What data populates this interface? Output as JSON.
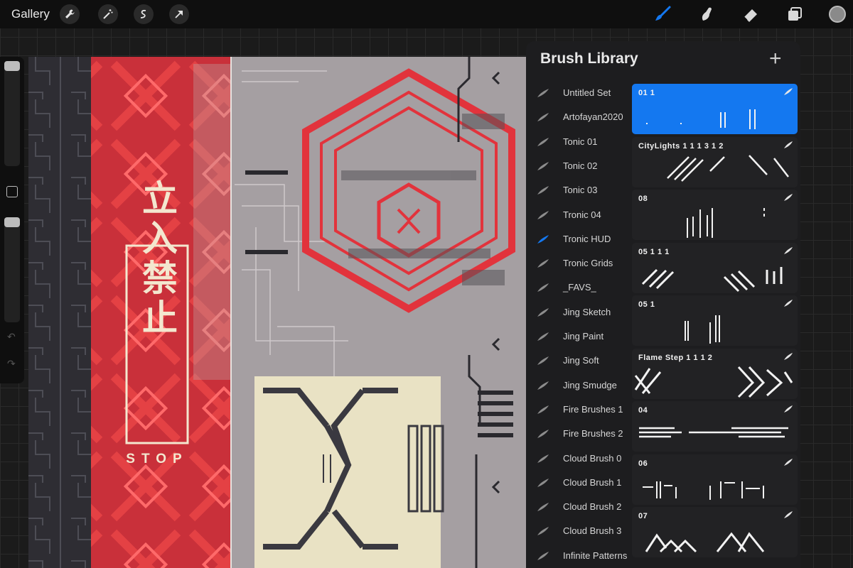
{
  "topbar": {
    "gallery_label": "Gallery",
    "left_tools": [
      "wrench-icon",
      "magic-wand-icon",
      "selection-icon",
      "transform-arrow-icon"
    ],
    "right_tools": [
      "brush-icon",
      "smudge-icon",
      "eraser-icon",
      "layers-icon",
      "color-icon"
    ],
    "accent_color": "#1478f0"
  },
  "canvas": {
    "sign_text": "立入禁止",
    "stop_text": "STOP"
  },
  "panel": {
    "title": "Brush Library",
    "add_label": "+",
    "sets": [
      {
        "label": "Untitled Set",
        "active": false
      },
      {
        "label": "Artofayan2020",
        "active": false
      },
      {
        "label": "Tonic 01",
        "active": false
      },
      {
        "label": "Tonic 02",
        "active": false
      },
      {
        "label": "Tonic 03",
        "active": false
      },
      {
        "label": "Tronic 04",
        "active": false
      },
      {
        "label": "Tronic HUD",
        "active": true
      },
      {
        "label": "Tronic Grids",
        "active": false
      },
      {
        "label": "_FAVS_",
        "active": false
      },
      {
        "label": "Jing Sketch",
        "active": false
      },
      {
        "label": "Jing Paint",
        "active": false
      },
      {
        "label": "Jing Soft",
        "active": false
      },
      {
        "label": "Jing Smudge",
        "active": false
      },
      {
        "label": "Fire Brushes 1",
        "active": false
      },
      {
        "label": "Fire Brushes 2",
        "active": false
      },
      {
        "label": "Cloud Brush 0",
        "active": false
      },
      {
        "label": "Cloud Brush 1",
        "active": false
      },
      {
        "label": "Cloud Brush 2",
        "active": false
      },
      {
        "label": "Cloud Brush 3",
        "active": false
      },
      {
        "label": "Infinite Patterns",
        "active": false
      }
    ],
    "brushes": [
      {
        "name": "01 1",
        "selected": true
      },
      {
        "name": "CityLights 1 1 1 3 1 2",
        "selected": false
      },
      {
        "name": "08",
        "selected": false
      },
      {
        "name": "05 1 1 1",
        "selected": false
      },
      {
        "name": "05 1",
        "selected": false
      },
      {
        "name": "Flame Step 1 1 1 2",
        "selected": false
      },
      {
        "name": "04",
        "selected": false
      },
      {
        "name": "06",
        "selected": false
      },
      {
        "name": "07",
        "selected": false
      }
    ]
  }
}
